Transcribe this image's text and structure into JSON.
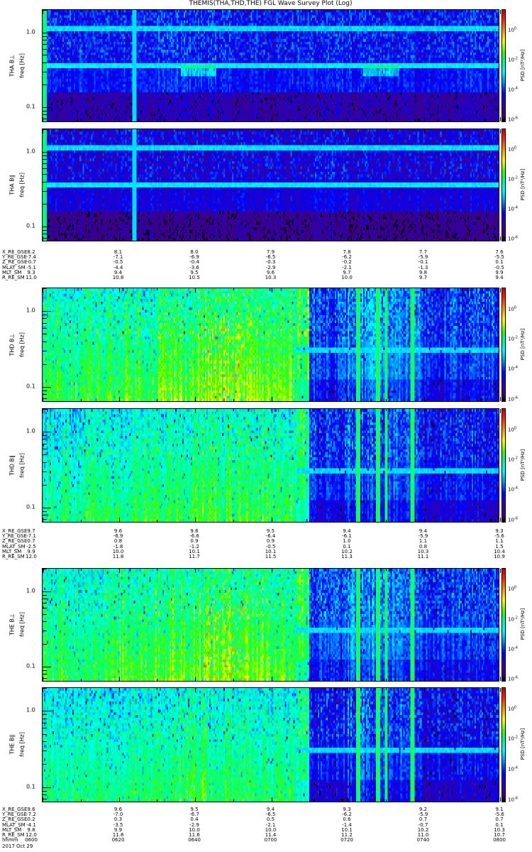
{
  "title": "THEMIS(THA,THD,THE) FGL Wave Survey Plot (Log)",
  "chart_data": {
    "type": "heatmap",
    "title": "THEMIS(THA,THD,THE) FGL Wave Survey Plot (Log)",
    "date_label": "2017 Oct 29",
    "time_ticks": [
      "0600",
      "0620",
      "0640",
      "0700",
      "0720",
      "0740",
      "0800"
    ],
    "freq_range_hz": [
      0.062,
      2.0
    ],
    "freq_scale": "log",
    "freq_tick_labels": [
      "0.1",
      "1.0"
    ],
    "colorbar": {
      "label": "PSD [nT²/Hz]",
      "log_range": [
        -6.2,
        1.4
      ],
      "tick_labels": [
        {
          "base": "10",
          "exp": "0"
        },
        {
          "base": "10",
          "exp": "-2"
        },
        {
          "base": "10",
          "exp": "-4"
        },
        {
          "base": "10",
          "exp": "-6"
        }
      ],
      "tick_values": [
        0,
        -2,
        -4,
        -6
      ]
    },
    "panels": [
      {
        "probe": "THA",
        "component": "B⊥",
        "ylabel": "THA B⊥",
        "freq_label": "freq [Hz]",
        "log_psd_profile": [
          -4.3,
          -4.3,
          -4.2,
          -4.1,
          -4.2,
          -4.3,
          -4.3,
          -4.2,
          -4.3,
          -4.3,
          -4.3,
          -4.2
        ]
      },
      {
        "probe": "THA",
        "component": "B∥",
        "ylabel": "THA B∥",
        "freq_label": "freq [Hz]",
        "log_psd_profile": [
          -4.6,
          -4.6,
          -4.5,
          -4.6,
          -4.6,
          -4.6,
          -4.6,
          -4.5,
          -4.6,
          -4.6,
          -4.6,
          -4.6
        ]
      },
      {
        "probe": "THD",
        "component": "B⊥",
        "ylabel": "THD B⊥",
        "freq_label": "freq [Hz]",
        "log_psd_profile": [
          -2.0,
          -1.9,
          -1.8,
          -1.6,
          -1.5,
          -1.5,
          -1.6,
          -3.9,
          -3.5,
          -3.6,
          -4.0,
          -4.0
        ]
      },
      {
        "probe": "THD",
        "component": "B∥",
        "ylabel": "THD B∥",
        "freq_label": "freq [Hz]",
        "log_psd_profile": [
          -2.2,
          -2.1,
          -2.1,
          -2.0,
          -1.9,
          -1.9,
          -2.0,
          -4.2,
          -3.8,
          -3.9,
          -4.3,
          -4.3
        ]
      },
      {
        "probe": "THE",
        "component": "B⊥",
        "ylabel": "THE B⊥",
        "freq_label": "freq [Hz]",
        "log_psd_profile": [
          -2.0,
          -1.9,
          -1.7,
          -1.6,
          -1.5,
          -1.5,
          -1.7,
          -3.9,
          -3.5,
          -3.7,
          -4.0,
          -4.0
        ]
      },
      {
        "probe": "THE",
        "component": "B∥",
        "ylabel": "THE B∥",
        "freq_label": "freq [Hz]",
        "log_psd_profile": [
          -2.3,
          -2.2,
          -2.1,
          -2.0,
          -2.0,
          -2.1,
          -2.2,
          -4.3,
          -3.9,
          -4.0,
          -4.4,
          -4.4
        ]
      }
    ],
    "ephemeris": [
      {
        "rows": [
          {
            "name": "X_RE_GSE",
            "values": [
              "8.2",
              "8.1",
              "8.0",
              "7.9",
              "7.8",
              "7.7",
              "7.6"
            ]
          },
          {
            "name": "Y_RE_GSE",
            "values": [
              "-7.4",
              "-7.1",
              "-6.9",
              "-6.5",
              "-6.2",
              "-5.9",
              "-5.5"
            ]
          },
          {
            "name": "Z_RE_GSE",
            "values": [
              "-0.7",
              "-0.5",
              "-0.4",
              "-0.3",
              "-0.2",
              "-0.1",
              "0.1"
            ]
          },
          {
            "name": "MLAT_SM",
            "values": [
              "-5.1",
              "-4.4",
              "-3.6",
              "-2.9",
              "-2.1",
              "-1.3",
              "-0.5"
            ]
          },
          {
            "name": "MLT_SM",
            "values": [
              "9.3",
              "9.4",
              "9.5",
              "9.6",
              "9.7",
              "9.8",
              "9.9"
            ]
          },
          {
            "name": "R_RE_SM",
            "values": [
              "11.0",
              "10.8",
              "10.5",
              "10.3",
              "10.0",
              "9.7",
              "9.4"
            ]
          }
        ]
      },
      {
        "rows": [
          {
            "name": "X_RE_GSE",
            "values": [
              "9.7",
              "9.6",
              "9.6",
              "9.5",
              "9.4",
              "9.4",
              "9.3"
            ]
          },
          {
            "name": "Y_RE_GSE",
            "values": [
              "-7.1",
              "-6.9",
              "-6.6",
              "-6.4",
              "-6.1",
              "-5.9",
              "-5.6"
            ]
          },
          {
            "name": "Z_RE_GSE",
            "values": [
              "0.7",
              "0.8",
              "0.9",
              "0.9",
              "1.0",
              "1.1",
              "1.1"
            ]
          },
          {
            "name": "MLAT_SM",
            "values": [
              "-2.5",
              "-1.8",
              "-1.2",
              "-0.5",
              "0.1",
              "0.8",
              "1.5"
            ]
          },
          {
            "name": "MLT_SM",
            "values": [
              "9.9",
              "10.0",
              "10.1",
              "10.1",
              "10.2",
              "10.3",
              "10.4"
            ]
          },
          {
            "name": "R_RE_SM",
            "values": [
              "12.0",
              "11.8",
              "11.7",
              "11.5",
              "11.3",
              "11.1",
              "10.9"
            ]
          }
        ]
      },
      {
        "rows": [
          {
            "name": "X_RE_GSE",
            "values": [
              "9.6",
              "9.6",
              "9.5",
              "9.4",
              "9.3",
              "9.2",
              "9.1"
            ]
          },
          {
            "name": "Y_RE_GSE",
            "values": [
              "-7.2",
              "-7.0",
              "-6.7",
              "-6.5",
              "-6.2",
              "-5.9",
              "-5.6"
            ]
          },
          {
            "name": "Z_RE_GSE",
            "values": [
              "0.2",
              "0.3",
              "0.4",
              "0.5",
              "0.6",
              "0.7",
              "0.7"
            ]
          },
          {
            "name": "MLAT_SM",
            "values": [
              "-4.1",
              "-3.5",
              "-2.9",
              "-2.1",
              "-1.4",
              "-0.7",
              "0.1"
            ]
          },
          {
            "name": "MLT_SM",
            "values": [
              "9.8",
              "9.9",
              "10.0",
              "10.0",
              "10.1",
              "10.2",
              "10.3"
            ]
          },
          {
            "name": "R_RE_SM",
            "values": [
              "12.0",
              "11.8",
              "11.6",
              "11.4",
              "11.2",
              "11.0",
              "10.7"
            ]
          },
          {
            "name": "hhmm",
            "values": [
              "0600",
              "0620",
              "0640",
              "0700",
              "0720",
              "0740",
              "0800"
            ]
          }
        ]
      }
    ]
  }
}
